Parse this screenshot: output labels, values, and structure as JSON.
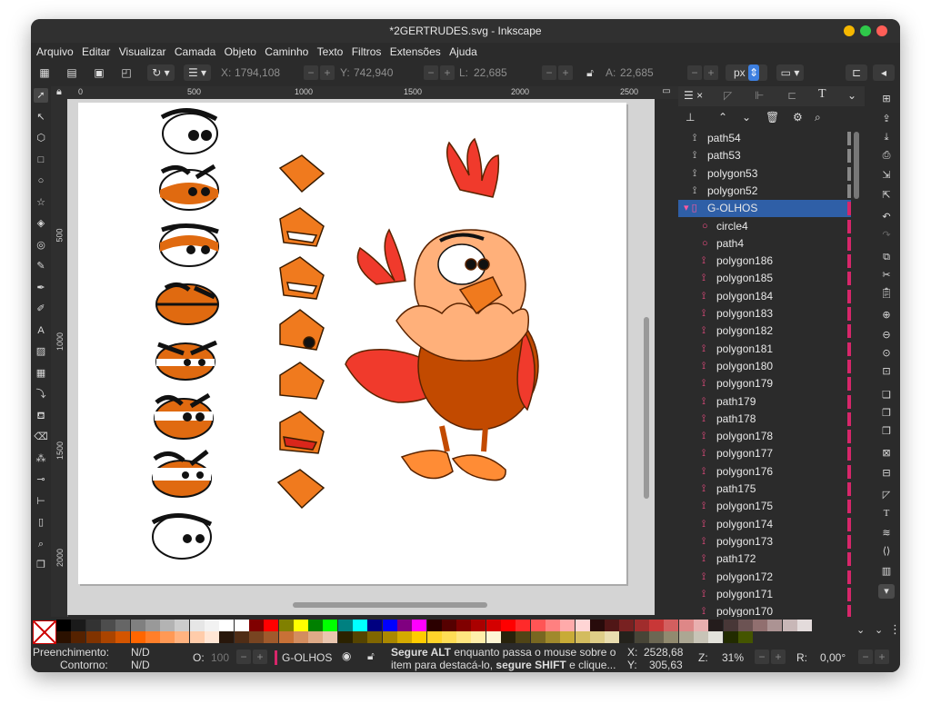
{
  "window": {
    "title": "*2GERTRUDES.svg - Inkscape"
  },
  "menu": [
    "Arquivo",
    "Editar",
    "Visualizar",
    "Camada",
    "Objeto",
    "Caminho",
    "Texto",
    "Filtros",
    "Extensões",
    "Ajuda"
  ],
  "toolbar": {
    "x_label": "X:",
    "x_value": "1794,108",
    "y_label": "Y:",
    "y_value": "742,940",
    "w_label": "L:",
    "w_value": "22,685",
    "h_label": "A:",
    "h_value": "22,685",
    "unit": "px"
  },
  "ruler_top": [
    "0",
    "500",
    "1000",
    "1500",
    "2000",
    "2500"
  ],
  "ruler_left": [
    "500",
    "1000",
    "1500",
    "2000"
  ],
  "layers": [
    {
      "name": "path54",
      "type": "path",
      "indent": 0,
      "mark": "#888888"
    },
    {
      "name": "path53",
      "type": "path",
      "indent": 0,
      "mark": "#888888"
    },
    {
      "name": "polygon53",
      "type": "path",
      "indent": 0,
      "mark": "#888888"
    },
    {
      "name": "polygon52",
      "type": "path",
      "indent": 0,
      "mark": "#888888"
    },
    {
      "name": "G-OLHOS",
      "type": "group",
      "indent": 0,
      "mark": "#d7266a",
      "selected": true
    },
    {
      "name": "circle4",
      "type": "circle",
      "indent": 1,
      "mark": "#d7266a"
    },
    {
      "name": "path4",
      "type": "circle",
      "indent": 1,
      "mark": "#d7266a"
    },
    {
      "name": "polygon186",
      "type": "path",
      "indent": 1,
      "mark": "#d7266a"
    },
    {
      "name": "polygon185",
      "type": "path",
      "indent": 1,
      "mark": "#d7266a"
    },
    {
      "name": "polygon184",
      "type": "path",
      "indent": 1,
      "mark": "#d7266a"
    },
    {
      "name": "polygon183",
      "type": "path",
      "indent": 1,
      "mark": "#d7266a"
    },
    {
      "name": "polygon182",
      "type": "path",
      "indent": 1,
      "mark": "#d7266a"
    },
    {
      "name": "polygon181",
      "type": "path",
      "indent": 1,
      "mark": "#d7266a"
    },
    {
      "name": "polygon180",
      "type": "path",
      "indent": 1,
      "mark": "#d7266a"
    },
    {
      "name": "polygon179",
      "type": "path",
      "indent": 1,
      "mark": "#d7266a"
    },
    {
      "name": "path179",
      "type": "path",
      "indent": 1,
      "mark": "#d7266a"
    },
    {
      "name": "path178",
      "type": "path",
      "indent": 1,
      "mark": "#d7266a"
    },
    {
      "name": "polygon178",
      "type": "path",
      "indent": 1,
      "mark": "#d7266a"
    },
    {
      "name": "polygon177",
      "type": "path",
      "indent": 1,
      "mark": "#d7266a"
    },
    {
      "name": "polygon176",
      "type": "path",
      "indent": 1,
      "mark": "#d7266a"
    },
    {
      "name": "path175",
      "type": "path",
      "indent": 1,
      "mark": "#d7266a"
    },
    {
      "name": "polygon175",
      "type": "path",
      "indent": 1,
      "mark": "#d7266a"
    },
    {
      "name": "polygon174",
      "type": "path",
      "indent": 1,
      "mark": "#d7266a"
    },
    {
      "name": "polygon173",
      "type": "path",
      "indent": 1,
      "mark": "#d7266a"
    },
    {
      "name": "path172",
      "type": "path",
      "indent": 1,
      "mark": "#d7266a"
    },
    {
      "name": "polygon172",
      "type": "path",
      "indent": 1,
      "mark": "#d7266a"
    },
    {
      "name": "polygon171",
      "type": "path",
      "indent": 1,
      "mark": "#d7266a"
    },
    {
      "name": "polygon170",
      "type": "path",
      "indent": 1,
      "mark": "#d7266a"
    }
  ],
  "palette_top": [
    "#000000",
    "#1a1a1a",
    "#333333",
    "#4d4d4d",
    "#666666",
    "#808080",
    "#999999",
    "#b3b3b3",
    "#cccccc",
    "#e6e6e6",
    "#f2f2f2",
    "#ffffff",
    "#ffffff",
    "#800000",
    "#ff0000",
    "#808000",
    "#ffff00",
    "#008000",
    "#00ff00",
    "#008080",
    "#00ffff",
    "#000080",
    "#0000ff",
    "#800080",
    "#ff00ff",
    "#2b0000",
    "#550000",
    "#800000",
    "#aa0000",
    "#d40000",
    "#ff0000",
    "#ff2a2a",
    "#ff5555",
    "#ff8080",
    "#ffaaaa",
    "#ffd5d5",
    "#280b0b",
    "#501616",
    "#782121",
    "#a02c2c",
    "#c83737",
    "#d35f5f",
    "#de8787",
    "#e9afaf",
    "#241c1c",
    "#483737",
    "#6c5353",
    "#916f6f",
    "#ac9393",
    "#c8b7b7",
    "#e3dbdb"
  ],
  "palette_bottom": [
    "#2b1100",
    "#552200",
    "#803300",
    "#aa4400",
    "#d45500",
    "#ff6600",
    "#ff7f2a",
    "#ff9955",
    "#ffb380",
    "#ffccaa",
    "#ffe6d5",
    "#28170b",
    "#502d16",
    "#784421",
    "#a05a2c",
    "#c87137",
    "#d38d5f",
    "#deaa87",
    "#e9c6af",
    "#2b2200",
    "#554400",
    "#806600",
    "#aa8800",
    "#d4aa00",
    "#ffcc00",
    "#ffd42a",
    "#ffdd55",
    "#ffe680",
    "#ffeeaa",
    "#fff6d5",
    "#28220b",
    "#504416",
    "#786721",
    "#a0892c",
    "#c8ab37",
    "#d3bc5f",
    "#decd87",
    "#e9ddaf",
    "#24221c",
    "#484537",
    "#6c6753",
    "#918a6f",
    "#aca793",
    "#c8c4b7",
    "#e3e2db",
    "#222b00",
    "#445500"
  ],
  "status": {
    "fill_label": "Preenchimento:",
    "fill_value": "N/D",
    "stroke_label": "Contorno:",
    "stroke_value": "N/D",
    "opacity_label": "O:",
    "opacity_value": "100",
    "layer": "G-OLHOS",
    "hint_bold1": "Segure ALT",
    "hint_text1": " enquanto passa o mouse sobre o",
    "hint_text2": "item para destacá-lo, ",
    "hint_bold2": "segure SHIFT",
    "hint_text3": " e clique...",
    "x_label": "X:",
    "x_value": "2528,68",
    "y_label": "Y:",
    "y_value": "305,63",
    "zoom_label": "Z:",
    "zoom_value": "31%",
    "rot_label": "R:",
    "rot_value": "0,00°"
  }
}
